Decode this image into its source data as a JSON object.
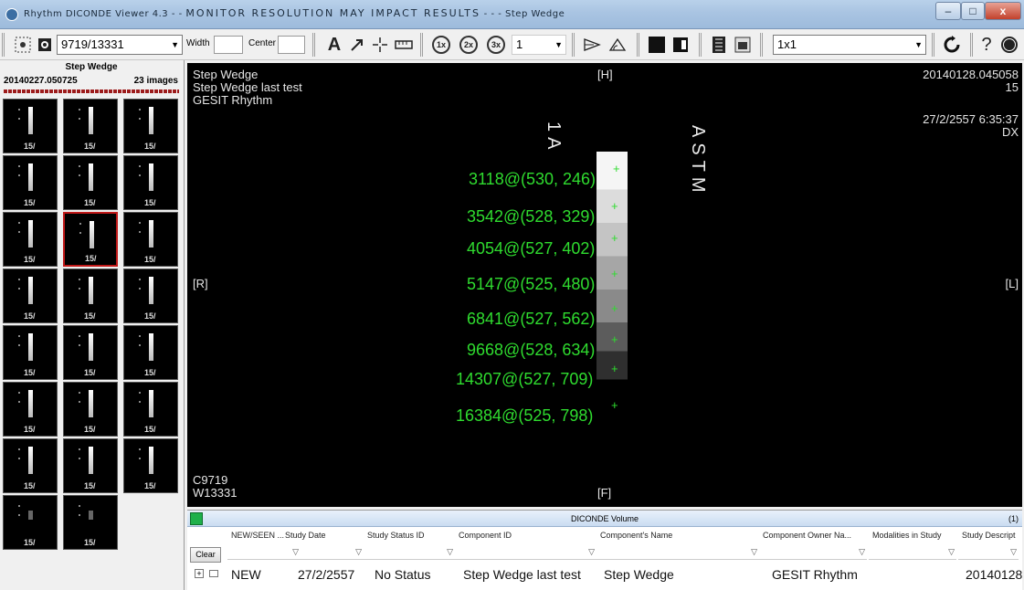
{
  "window": {
    "title_prefix": "Rhythm DICONDE Viewer 4.3 - - ",
    "title_warning": "MONITOR RESOLUTION MAY IMPACT RESULTS",
    "title_suffix": " - - - Step Wedge",
    "minimize": "–",
    "maximize": "□",
    "close": "x"
  },
  "toolbar": {
    "image_index": "9719/13331",
    "width_label": "Width",
    "center_label": "Center",
    "text_tool": "A",
    "zoom_1x": "1x",
    "zoom_2x": "2x",
    "zoom_3x": "3x",
    "zoom_value": "1",
    "layout": "1x1",
    "help": "?"
  },
  "left_panel": {
    "title": "Step Wedge",
    "date": "20140227.050725",
    "count": "23 images",
    "thumb_caption": "15/"
  },
  "viewer": {
    "top_left": [
      "Step Wedge",
      "Step Wedge last test",
      "GESIT Rhythm"
    ],
    "top_center": "[H]",
    "top_right": [
      "20140128.045058",
      "15"
    ],
    "datetime": "27/2/2557 6:35:37",
    "modality": "DX",
    "left_marker": "[R]",
    "right_marker": "[L]",
    "bottom_left": [
      "C9719",
      "W13331"
    ],
    "bottom_center": "[F]",
    "wedge_label_1": "1A",
    "wedge_label_2": "ASTM",
    "rois": [
      "3118@(530, 246)",
      "3542@(528, 329)",
      "4054@(527, 402)",
      "5147@(525, 480)",
      "6841@(527, 562)",
      "9668@(528, 634)",
      "14307@(527, 709)",
      "16384@(525, 798)"
    ]
  },
  "bottom_panel": {
    "title": "DICONDE Volume",
    "count": "(1)",
    "clear": "Clear",
    "columns": [
      "NEW/SEEN ...",
      "Study Date",
      "Study Status ID",
      "Component ID",
      "Component's Name",
      "Component Owner Na...",
      "Modalities in Study",
      "Study Descript"
    ],
    "row": {
      "expand": "+",
      "status": "NEW",
      "date": "27/2/2557",
      "status_id": "No Status",
      "component_id": "Step Wedge last test",
      "name": "Step Wedge",
      "owner": "GESIT Rhythm",
      "description": "20140128"
    }
  }
}
